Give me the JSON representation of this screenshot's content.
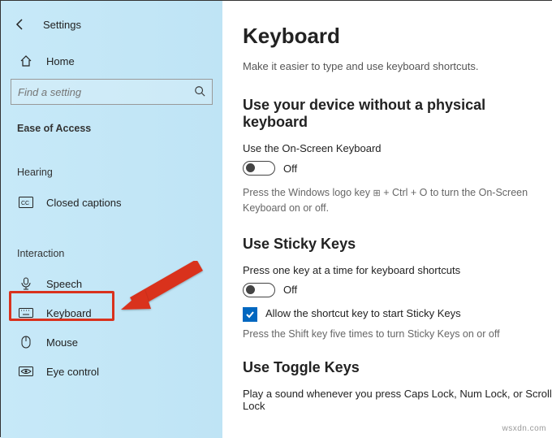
{
  "header": {
    "back_icon": "←",
    "app_title": "Settings"
  },
  "home": {
    "label": "Home"
  },
  "search": {
    "placeholder": "Find a setting"
  },
  "category": {
    "label": "Ease of Access"
  },
  "groups": {
    "hearing": {
      "label": "Hearing",
      "items": [
        {
          "label": "Closed captions",
          "icon": "cc"
        }
      ]
    },
    "interaction": {
      "label": "Interaction",
      "items": [
        {
          "label": "Speech",
          "icon": "mic"
        },
        {
          "label": "Keyboard",
          "icon": "keyboard",
          "selected": true
        },
        {
          "label": "Mouse",
          "icon": "mouse"
        },
        {
          "label": "Eye control",
          "icon": "eye"
        }
      ]
    }
  },
  "main": {
    "title": "Keyboard",
    "subtitle": "Make it easier to type and use keyboard shortcuts.",
    "section1": {
      "heading": "Use your device without a physical keyboard",
      "label": "Use the On-Screen Keyboard",
      "toggle_state": "Off",
      "help_pre": "Press the Windows logo key ",
      "help_post": " + Ctrl + O to turn the On-Screen Keyboard on or off."
    },
    "section2": {
      "heading": "Use Sticky Keys",
      "label": "Press one key at a time for keyboard shortcuts",
      "toggle_state": "Off",
      "checkbox_label": "Allow the shortcut key to start Sticky Keys",
      "checkbox_checked": true,
      "help": "Press the Shift key five times to turn Sticky Keys on or off"
    },
    "section3": {
      "heading": "Use Toggle Keys",
      "label": "Play a sound whenever you press Caps Lock, Num Lock, or Scroll Lock"
    }
  },
  "watermark": "wsxdn.com"
}
